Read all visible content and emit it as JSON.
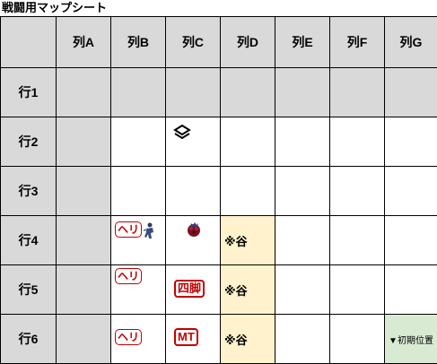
{
  "title": "戦闘用マップシート",
  "columns": [
    "",
    "列A",
    "列B",
    "列C",
    "列D",
    "列E",
    "列F",
    "列G"
  ],
  "rows": [
    "行1",
    "行2",
    "行3",
    "行4",
    "行5",
    "行6"
  ],
  "cells": {
    "valley_label": "※谷",
    "start_label": "▼初期位置",
    "heli_label": "ヘリ",
    "shikyaku_label": "四脚",
    "mt_label": "MT"
  },
  "colors": {
    "header_gray": "#d9d9d9",
    "valley_yellow": "#fff2cc",
    "start_green": "#d9ead3",
    "unit_red": "#c00000"
  },
  "icons": [
    "diamond-layers-icon",
    "soldier-figure-icon",
    "monster-figure-icon"
  ]
}
